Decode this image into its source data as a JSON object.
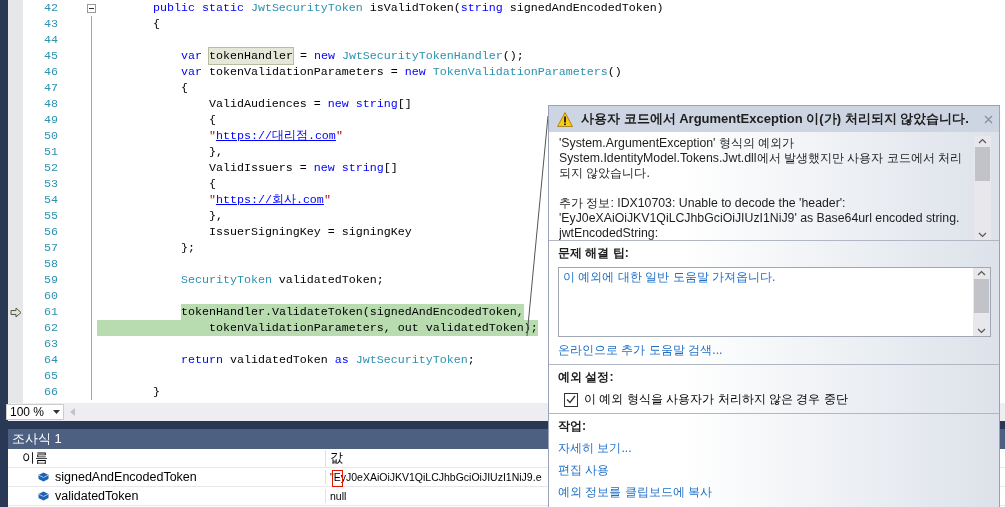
{
  "editor": {
    "lines": [
      {
        "number": "42",
        "fold": true,
        "current": false,
        "highlighted": false,
        "segments": [
          {
            "kind": "keyword",
            "text": "        public static "
          },
          {
            "kind": "type",
            "text": "JwtSecurityToken"
          },
          {
            "kind": "plain",
            "text": " isValidToken("
          },
          {
            "kind": "keyword",
            "text": "string"
          },
          {
            "kind": "plain",
            "text": " signedAndEncodedToken)"
          }
        ]
      },
      {
        "number": "43",
        "fold": false,
        "current": false,
        "highlighted": false,
        "segments": [
          {
            "kind": "plain",
            "text": "        {"
          }
        ]
      },
      {
        "number": "44",
        "fold": false,
        "current": false,
        "highlighted": false
      },
      {
        "number": "45",
        "fold": false,
        "current": false,
        "highlighted": false,
        "segments": [
          {
            "kind": "keyword",
            "text": "            var"
          },
          {
            "kind": "reference",
            "text": " tokenHandler"
          },
          {
            "kind": "plain",
            "text": " = "
          },
          {
            "kind": "keyword",
            "text": "new"
          },
          {
            "kind": "type",
            "text": " JwtSecurityTokenHandler"
          },
          {
            "kind": "plain",
            "text": "();"
          }
        ]
      },
      {
        "number": "46",
        "fold": false,
        "current": false,
        "highlighted": false,
        "segments": [
          {
            "kind": "keyword",
            "text": "            var"
          },
          {
            "kind": "plain",
            "text": " tokenValidationParameters = "
          },
          {
            "kind": "keyword",
            "text": "new"
          },
          {
            "kind": "type",
            "text": " TokenValidationParameters"
          },
          {
            "kind": "plain",
            "text": "()"
          }
        ]
      },
      {
        "number": "47",
        "fold": false,
        "current": false,
        "highlighted": false,
        "segments": [
          {
            "kind": "plain",
            "text": "            {"
          }
        ]
      },
      {
        "number": "48",
        "fold": false,
        "current": false,
        "highlighted": false,
        "segments": [
          {
            "kind": "plain",
            "text": "                ValidAudiences = "
          },
          {
            "kind": "keyword",
            "text": "new string"
          },
          {
            "kind": "plain",
            "text": "[]"
          }
        ]
      },
      {
        "number": "49",
        "fold": false,
        "current": false,
        "highlighted": false,
        "segments": [
          {
            "kind": "plain",
            "text": "                {"
          }
        ]
      },
      {
        "number": "50",
        "fold": false,
        "current": false,
        "highlighted": false,
        "segments": [
          {
            "kind": "string",
            "text": "                \""
          },
          {
            "kind": "link",
            "text": "https://대리점.com"
          },
          {
            "kind": "string",
            "text": "\""
          }
        ]
      },
      {
        "number": "51",
        "fold": false,
        "current": false,
        "highlighted": false,
        "segments": [
          {
            "kind": "plain",
            "text": "                },"
          }
        ]
      },
      {
        "number": "52",
        "fold": false,
        "current": false,
        "highlighted": false,
        "segments": [
          {
            "kind": "plain",
            "text": "                ValidIssuers = "
          },
          {
            "kind": "keyword",
            "text": "new string"
          },
          {
            "kind": "plain",
            "text": "[]"
          }
        ]
      },
      {
        "number": "53",
        "fold": false,
        "current": false,
        "highlighted": false,
        "segments": [
          {
            "kind": "plain",
            "text": "                {"
          }
        ]
      },
      {
        "number": "54",
        "fold": false,
        "current": false,
        "highlighted": false,
        "segments": [
          {
            "kind": "string",
            "text": "                \""
          },
          {
            "kind": "link",
            "text": "https://회사.com"
          },
          {
            "kind": "string",
            "text": "\""
          }
        ]
      },
      {
        "number": "55",
        "fold": false,
        "current": false,
        "highlighted": false,
        "segments": [
          {
            "kind": "plain",
            "text": "                },"
          }
        ]
      },
      {
        "number": "56",
        "fold": false,
        "current": false,
        "highlighted": false,
        "segments": [
          {
            "kind": "plain",
            "text": "                IssuerSigningKey = signingKey"
          }
        ]
      },
      {
        "number": "57",
        "fold": false,
        "current": false,
        "highlighted": false,
        "segments": [
          {
            "kind": "plain",
            "text": "            };"
          }
        ]
      },
      {
        "number": "58",
        "fold": false,
        "current": false,
        "highlighted": false
      },
      {
        "number": "59",
        "fold": false,
        "current": false,
        "highlighted": false,
        "segments": [
          {
            "kind": "type",
            "text": "            SecurityToken"
          },
          {
            "kind": "plain",
            "text": " validatedToken;"
          }
        ]
      },
      {
        "number": "60",
        "fold": false,
        "current": false,
        "highlighted": false
      },
      {
        "number": "61",
        "fold": false,
        "current": true,
        "highlighted": true,
        "segments": [
          {
            "kind": "plain",
            "text": "            tokenHandler.ValidateToken(signedAndEncodedToken,"
          }
        ]
      },
      {
        "number": "62",
        "fold": false,
        "current": false,
        "highlighted": true,
        "segments": [
          {
            "kind": "plain",
            "text": "                tokenValidationParameters, out validatedToken);"
          }
        ]
      },
      {
        "number": "63",
        "fold": false,
        "current": false,
        "highlighted": false
      },
      {
        "number": "64",
        "fold": false,
        "current": false,
        "highlighted": false,
        "segments": [
          {
            "kind": "keyword",
            "text": "            return"
          },
          {
            "kind": "plain",
            "text": " validatedToken "
          },
          {
            "kind": "keyword",
            "text": "as"
          },
          {
            "kind": "type",
            "text": " JwtSecurityToken"
          },
          {
            "kind": "plain",
            "text": ";"
          }
        ]
      },
      {
        "number": "65",
        "fold": false,
        "current": false,
        "highlighted": false
      },
      {
        "number": "66",
        "fold": false,
        "current": false,
        "highlighted": false,
        "segments": [
          {
            "kind": "plain",
            "text": "        }"
          }
        ]
      }
    ],
    "zoom": "100 %"
  },
  "watch": {
    "title": "조사식 1",
    "columns": [
      "이름",
      "값"
    ],
    "rows": [
      {
        "name": "signedAndEncodedToken",
        "value": "\"EyJ0eXAiOiJKV1QiLCJhbGciOiJIUzI1NiJ9.e",
        "error": true
      },
      {
        "name": "validatedToken",
        "value": "null",
        "error": false
      }
    ]
  },
  "exception_popup": {
    "title": "사용자 코드에서 ArgumentException 이(가) 처리되지 않았습니다.",
    "message": [
      "'System.ArgumentException' 형식의 예외가 System.IdentityModel.Tokens.Jwt.dll에서 발생했지만 사용자 코드에서 처리되지 않았습니다.",
      "추가 정보: IDX10703: Unable to decode the 'header': 'EyJ0eXAiOiJKV1QiLCJhbGciOiJIUzI1NiJ9' as Base64url encoded string. jwtEncodedString:"
    ],
    "tips_heading": "문제 해결 팁:",
    "tips": [
      "이 예외에 대한 일반 도움말 가져옵니다."
    ],
    "online_help_link": "온라인으로 추가 도움말 검색...",
    "settings_heading": "예외 설정:",
    "settings": [
      {
        "label": "이 예외 형식을 사용자가 처리하지 않은 경우 중단",
        "checked": true
      }
    ],
    "actions_heading": "작업:",
    "actions": [
      "자세히 보기...",
      "편집 사용",
      "예외 정보를 클립보드에 복사"
    ]
  }
}
